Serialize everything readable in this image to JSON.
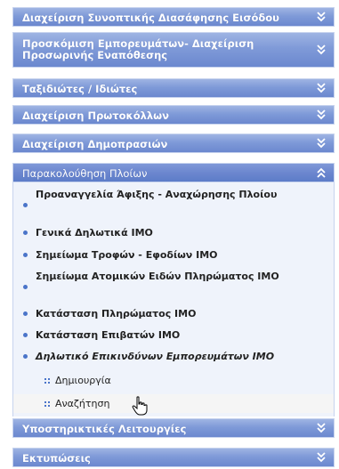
{
  "menu": {
    "sections": [
      {
        "label": "Διαχείριση Συνοπτικής Διασάφησης Εισόδου",
        "state": "collapsed"
      },
      {
        "label": "Προσκόμιση Εμπορευμάτων- Διαχείριση Προσωρινής Εναπόθεσης",
        "state": "collapsed"
      },
      {
        "label": "Ταξιδιώτες / Ιδιώτες",
        "state": "collapsed"
      },
      {
        "label": "Διαχείριση Πρωτοκόλλων",
        "state": "collapsed"
      },
      {
        "label": "Διαχείριση Δημοπρασιών",
        "state": "collapsed"
      },
      {
        "label": "Παρακολούθηση Πλοίων",
        "state": "expanded"
      },
      {
        "label": "Υποστηρικτικές Λειτουργίες",
        "state": "collapsed"
      },
      {
        "label": "Εκτυπώσεις",
        "state": "collapsed"
      }
    ],
    "items": [
      {
        "label": "Προαναγγελία Άφιξης - Αναχώρησης Πλοίου"
      },
      {
        "label": "Γενικά Δηλωτικά IMO"
      },
      {
        "label": "Σημείωμα Τροφών - Εφοδίων IMO"
      },
      {
        "label": "Σημείωμα Ατομικών Ειδών Πληρώματος IMO"
      },
      {
        "label": "Κατάσταση Πληρώματος IMO"
      },
      {
        "label": "Κατάσταση Επιβατών IMO"
      },
      {
        "label": "Δηλωτικό Επικινδύνων Εμπορευμάτων IMO"
      }
    ],
    "subitems": [
      {
        "label": "Δημιουργία"
      },
      {
        "label": "Αναζήτηση"
      }
    ]
  },
  "colors": {
    "header_gradient_top": "#9fb4e3",
    "header_gradient_bottom": "#6b88cf",
    "body_bg": "#eff3fb",
    "bullet": "#4a74c9"
  },
  "icons": {
    "collapsed": "chevron-double-down-icon",
    "expanded": "chevron-double-up-icon",
    "bullet": "bullet-icon",
    "subitem": "grid-bullet-icon",
    "cursor": "hand-pointer-cursor-icon"
  }
}
